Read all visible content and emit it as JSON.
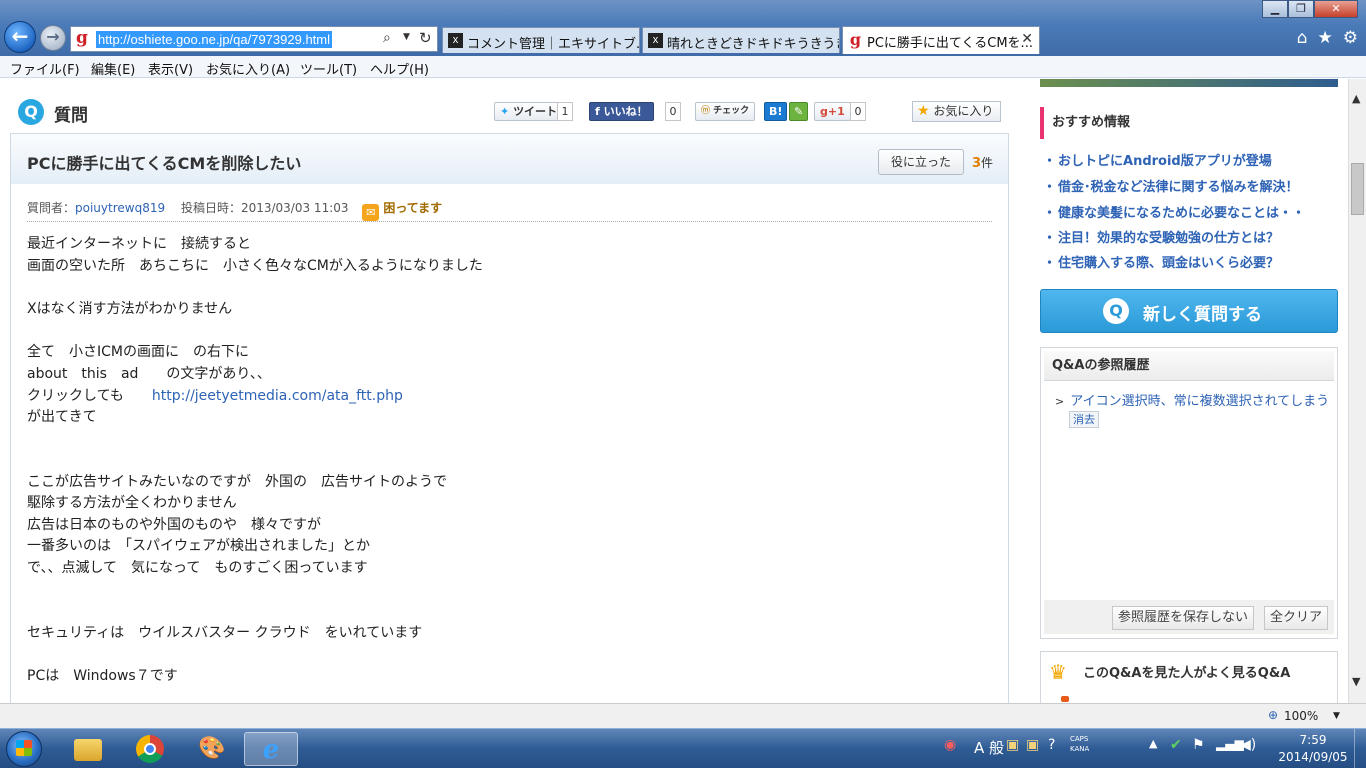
{
  "browser": {
    "address": "http://oshiete.goo.ne.jp/qa/7973929.html",
    "tabs": [
      {
        "title": "コメント管理｜エキサイトブ...",
        "icon": "x-favicon"
      },
      {
        "title": "晴れときどきドキドキうきうき",
        "icon": "x-favicon"
      },
      {
        "title": "PCに勝手に出てくるCMを...",
        "icon": "goo-favicon"
      }
    ]
  },
  "menu": [
    "ファイル(F)",
    "編集(E)",
    "表示(V)",
    "お気に入り(A)",
    "ツール(T)",
    "ヘルプ(H)"
  ],
  "question": {
    "section_label": "質問",
    "share": {
      "tweet": "ツイート",
      "tweet_count": "1",
      "like": "いいね！",
      "like_count": "0",
      "check": "チェック",
      "hatena": "B!",
      "gplus": "g+1",
      "gplus_count": "0",
      "favorite": "お気に入り"
    },
    "title": "PCに勝手に出てくるCMを削除したい",
    "helpful_button": "役に立った",
    "helpful_count": "3",
    "helpful_unit": "件",
    "meta": {
      "asker_label": "質問者：",
      "asker": "poiuytrewq819",
      "posted_label": "投稿日時：",
      "posted": "2013/03/03 11:03",
      "mood": "困ってます"
    },
    "body": {
      "l1": "最近インターネットに　接続すると",
      "l2": "画面の空いた所　あちこちに　小さく色々なCMが入るようになりました",
      "l3": "Xはなく消す方法がわかりません",
      "l4": "全て　小さICMの画面に　の右下に",
      "l5": "about　this　ad　　の文字があり、、",
      "l6": "クリックしても　　",
      "link": "http://jeetyetmedia.com/ata_ftt.php",
      "l7": "が出てきて",
      "l8": "ここが広告サイトみたいなのですが　外国の　広告サイトのようで",
      "l9": "駆除する方法が全くわかりません",
      "l10": "広告は日本のものや外国のものや　様々ですが",
      "l11": "一番多いのは　「スパイウェアが検出されました」とか",
      "l12": "で、、点滅して　気になって　ものすごく困っています",
      "l13": "セキュリティは　ウイルスバスター クラウド　をいれています",
      "l14": "PCは　Windows７です"
    }
  },
  "sidebar": {
    "recommended_title": "おすすめ情報",
    "recommended": [
      "おしトピにAndroid版アプリが登場",
      "借金･税金など法律に関する悩みを解決！",
      "健康な美髪になるために必要なことは・・",
      "注目！効果的な受験勉強の仕方とは？",
      "住宅購入する際、頭金はいくら必要？"
    ],
    "ask_button": "新しく質問する",
    "history_title": "Q&Aの参照履歴",
    "history_item": "アイコン選択時、常に複数選択されてしまう",
    "history_delete": "消去",
    "history_nosave": "参照履歴を保存しない",
    "history_clear": "全クリア",
    "also_viewed_title": "このQ&Aを見た人がよく見るQ&A"
  },
  "status": {
    "zoom": "100%"
  },
  "taskbar": {
    "ime": "A 般",
    "caps": "CAPS",
    "kana": "KANA",
    "time": "7:59",
    "date": "2014/09/05"
  },
  "colors": {
    "link": "#2e63b5",
    "accent_pink": "#e8336f",
    "ask_blue": "#2a9ad8",
    "helpful_orange": "#e07e00"
  }
}
